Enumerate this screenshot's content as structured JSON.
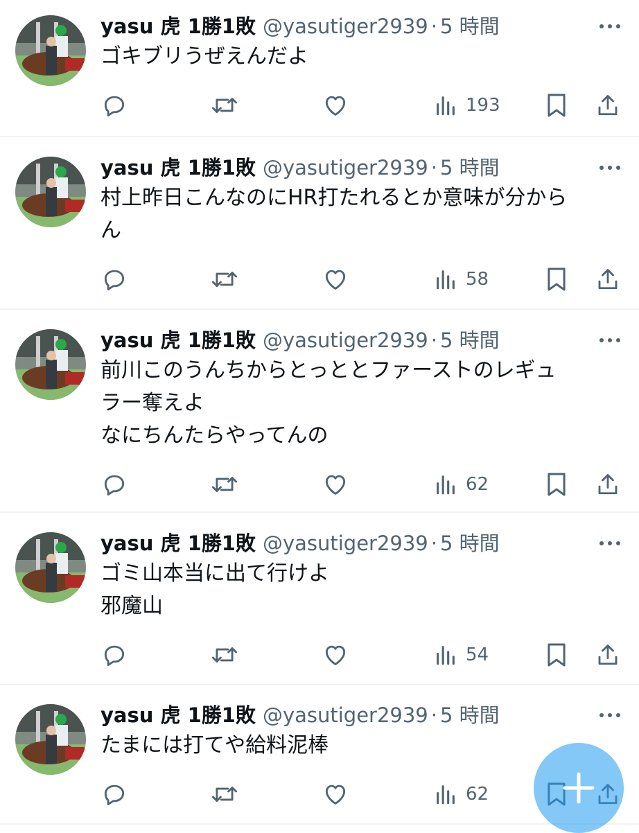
{
  "tweets": [
    {
      "name": "yasu 虎 1勝1敗",
      "handle": "@yasutiger2939",
      "dot": "·",
      "time": "5 時間",
      "lines": [
        "ゴキブリうぜえんだよ"
      ],
      "views": "193"
    },
    {
      "name": "yasu 虎 1勝1敗",
      "handle": "@yasutiger2939",
      "dot": "·",
      "time": "5 時間",
      "lines": [
        "村上昨日こんなのにHR打たれるとか意味が分から",
        "ん"
      ],
      "views": "58"
    },
    {
      "name": "yasu 虎 1勝1敗",
      "handle": "@yasutiger2939",
      "dot": "·",
      "time": "5 時間",
      "lines": [
        "前川このうんちからとっととファーストのレギュ",
        "ラー奪えよ",
        "なにちんたらやってんの"
      ],
      "views": "62"
    },
    {
      "name": "yasu 虎 1勝1敗",
      "handle": "@yasutiger2939",
      "dot": "·",
      "time": "5 時間",
      "lines": [
        "ゴミ山本当に出て行けよ",
        "邪魔山"
      ],
      "views": "54"
    },
    {
      "name": "yasu 虎 1勝1敗",
      "handle": "@yasutiger2939",
      "dot": "·",
      "time": "5 時間",
      "lines": [
        "たまには打てや給料泥棒"
      ],
      "views": "62"
    }
  ],
  "colors": {
    "text": "#0f1419",
    "secondary": "#536471",
    "divider": "#eff3f4",
    "accent": "#1d9bf0"
  },
  "icons": [
    "reply-icon",
    "retweet-icon",
    "like-icon",
    "views-icon",
    "bookmark-icon",
    "share-icon",
    "more-icon",
    "compose-icon"
  ]
}
